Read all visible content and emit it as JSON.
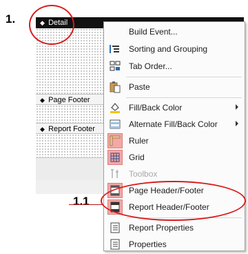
{
  "annotations": {
    "step1": "1.",
    "step11": "1.1"
  },
  "sections": {
    "detail": "Detail",
    "page_footer": "Page Footer",
    "report_footer": "Report Footer"
  },
  "menu": {
    "items": [
      {
        "label": "Build Event...",
        "icon": "blank",
        "disabled": false
      },
      {
        "label": "Sorting and Grouping",
        "icon": "sorting-grouping-icon",
        "disabled": false
      },
      {
        "label": "Tab Order...",
        "icon": "tab-order-icon",
        "disabled": false
      },
      {
        "label": "Paste",
        "icon": "paste-icon",
        "disabled": false
      },
      {
        "label": "Fill/Back Color",
        "icon": "fill-color-icon",
        "disabled": false,
        "submenu": true
      },
      {
        "label": "Alternate Fill/Back Color",
        "icon": "alternate-fill-icon",
        "disabled": false,
        "submenu": true
      },
      {
        "label": "Ruler",
        "icon": "ruler-icon",
        "disabled": false
      },
      {
        "label": "Grid",
        "icon": "grid-icon",
        "disabled": false
      },
      {
        "label": "Toolbox",
        "icon": "toolbox-icon",
        "disabled": true
      },
      {
        "label": "Page Header/Footer",
        "icon": "page-header-footer-icon",
        "disabled": false
      },
      {
        "label": "Report Header/Footer",
        "icon": "report-header-footer-icon",
        "disabled": false
      },
      {
        "label": "Report Properties",
        "icon": "report-properties-icon",
        "disabled": false
      },
      {
        "label": "Properties",
        "icon": "properties-icon",
        "disabled": false
      }
    ]
  },
  "colors": {
    "annotation_red": "#d81b1b",
    "icon_highlight": "#f4a7a7"
  }
}
